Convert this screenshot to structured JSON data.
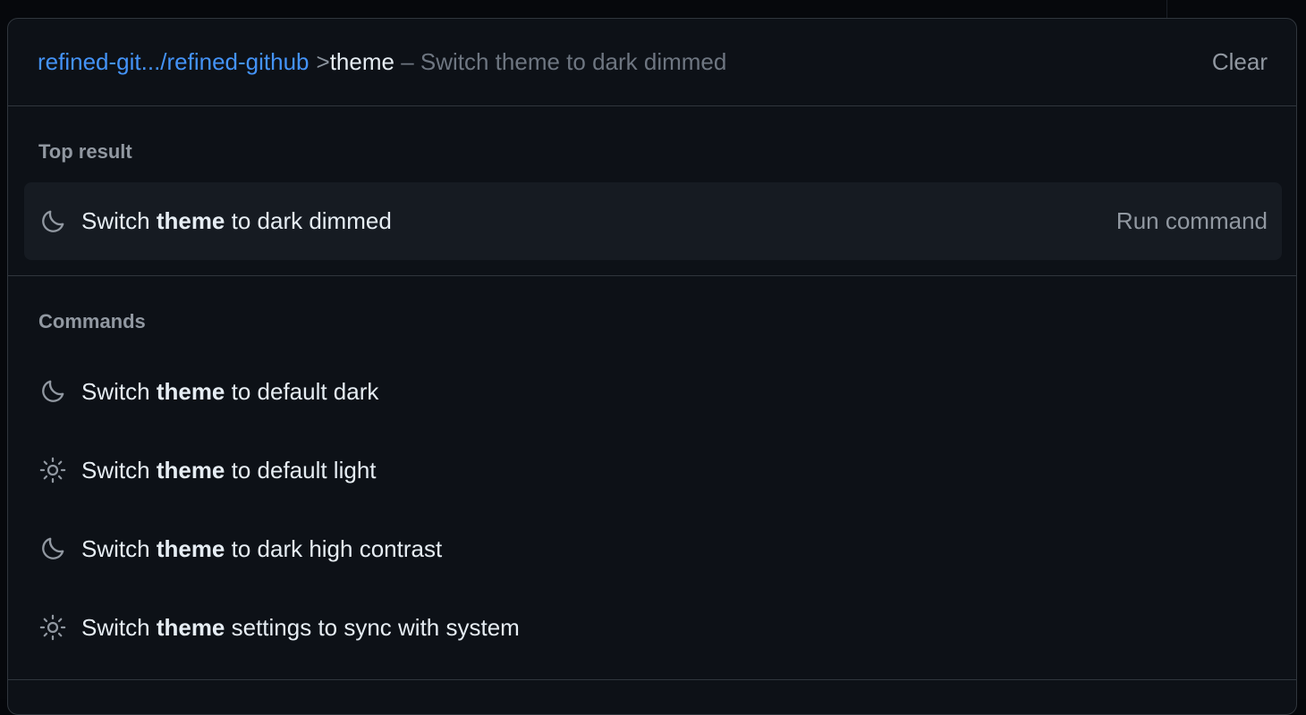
{
  "palette": {
    "scope": "refined-git.../refined-github",
    "prefix": ">",
    "term": "theme",
    "hint": " – Switch theme to dark dimmed",
    "clear_label": "Clear"
  },
  "top": {
    "title": "Top result",
    "item": {
      "icon": "moon-icon",
      "before": "Switch ",
      "bold": "theme",
      "after": " to dark dimmed",
      "action": "Run command"
    }
  },
  "commands": {
    "title": "Commands",
    "items": [
      {
        "icon": "moon-icon",
        "before": "Switch ",
        "bold": "theme",
        "after": " to default dark"
      },
      {
        "icon": "sun-icon",
        "before": "Switch ",
        "bold": "theme",
        "after": " to default light"
      },
      {
        "icon": "moon-icon",
        "before": "Switch ",
        "bold": "theme",
        "after": " to dark high contrast"
      },
      {
        "icon": "sun-icon",
        "before": "Switch ",
        "bold": "theme",
        "after": " settings to sync with system"
      }
    ]
  },
  "colors": {
    "background": "#0d1117",
    "border": "#30363d",
    "accent": "#4493f8",
    "muted": "#9198a1",
    "highlight": "#161b22"
  }
}
